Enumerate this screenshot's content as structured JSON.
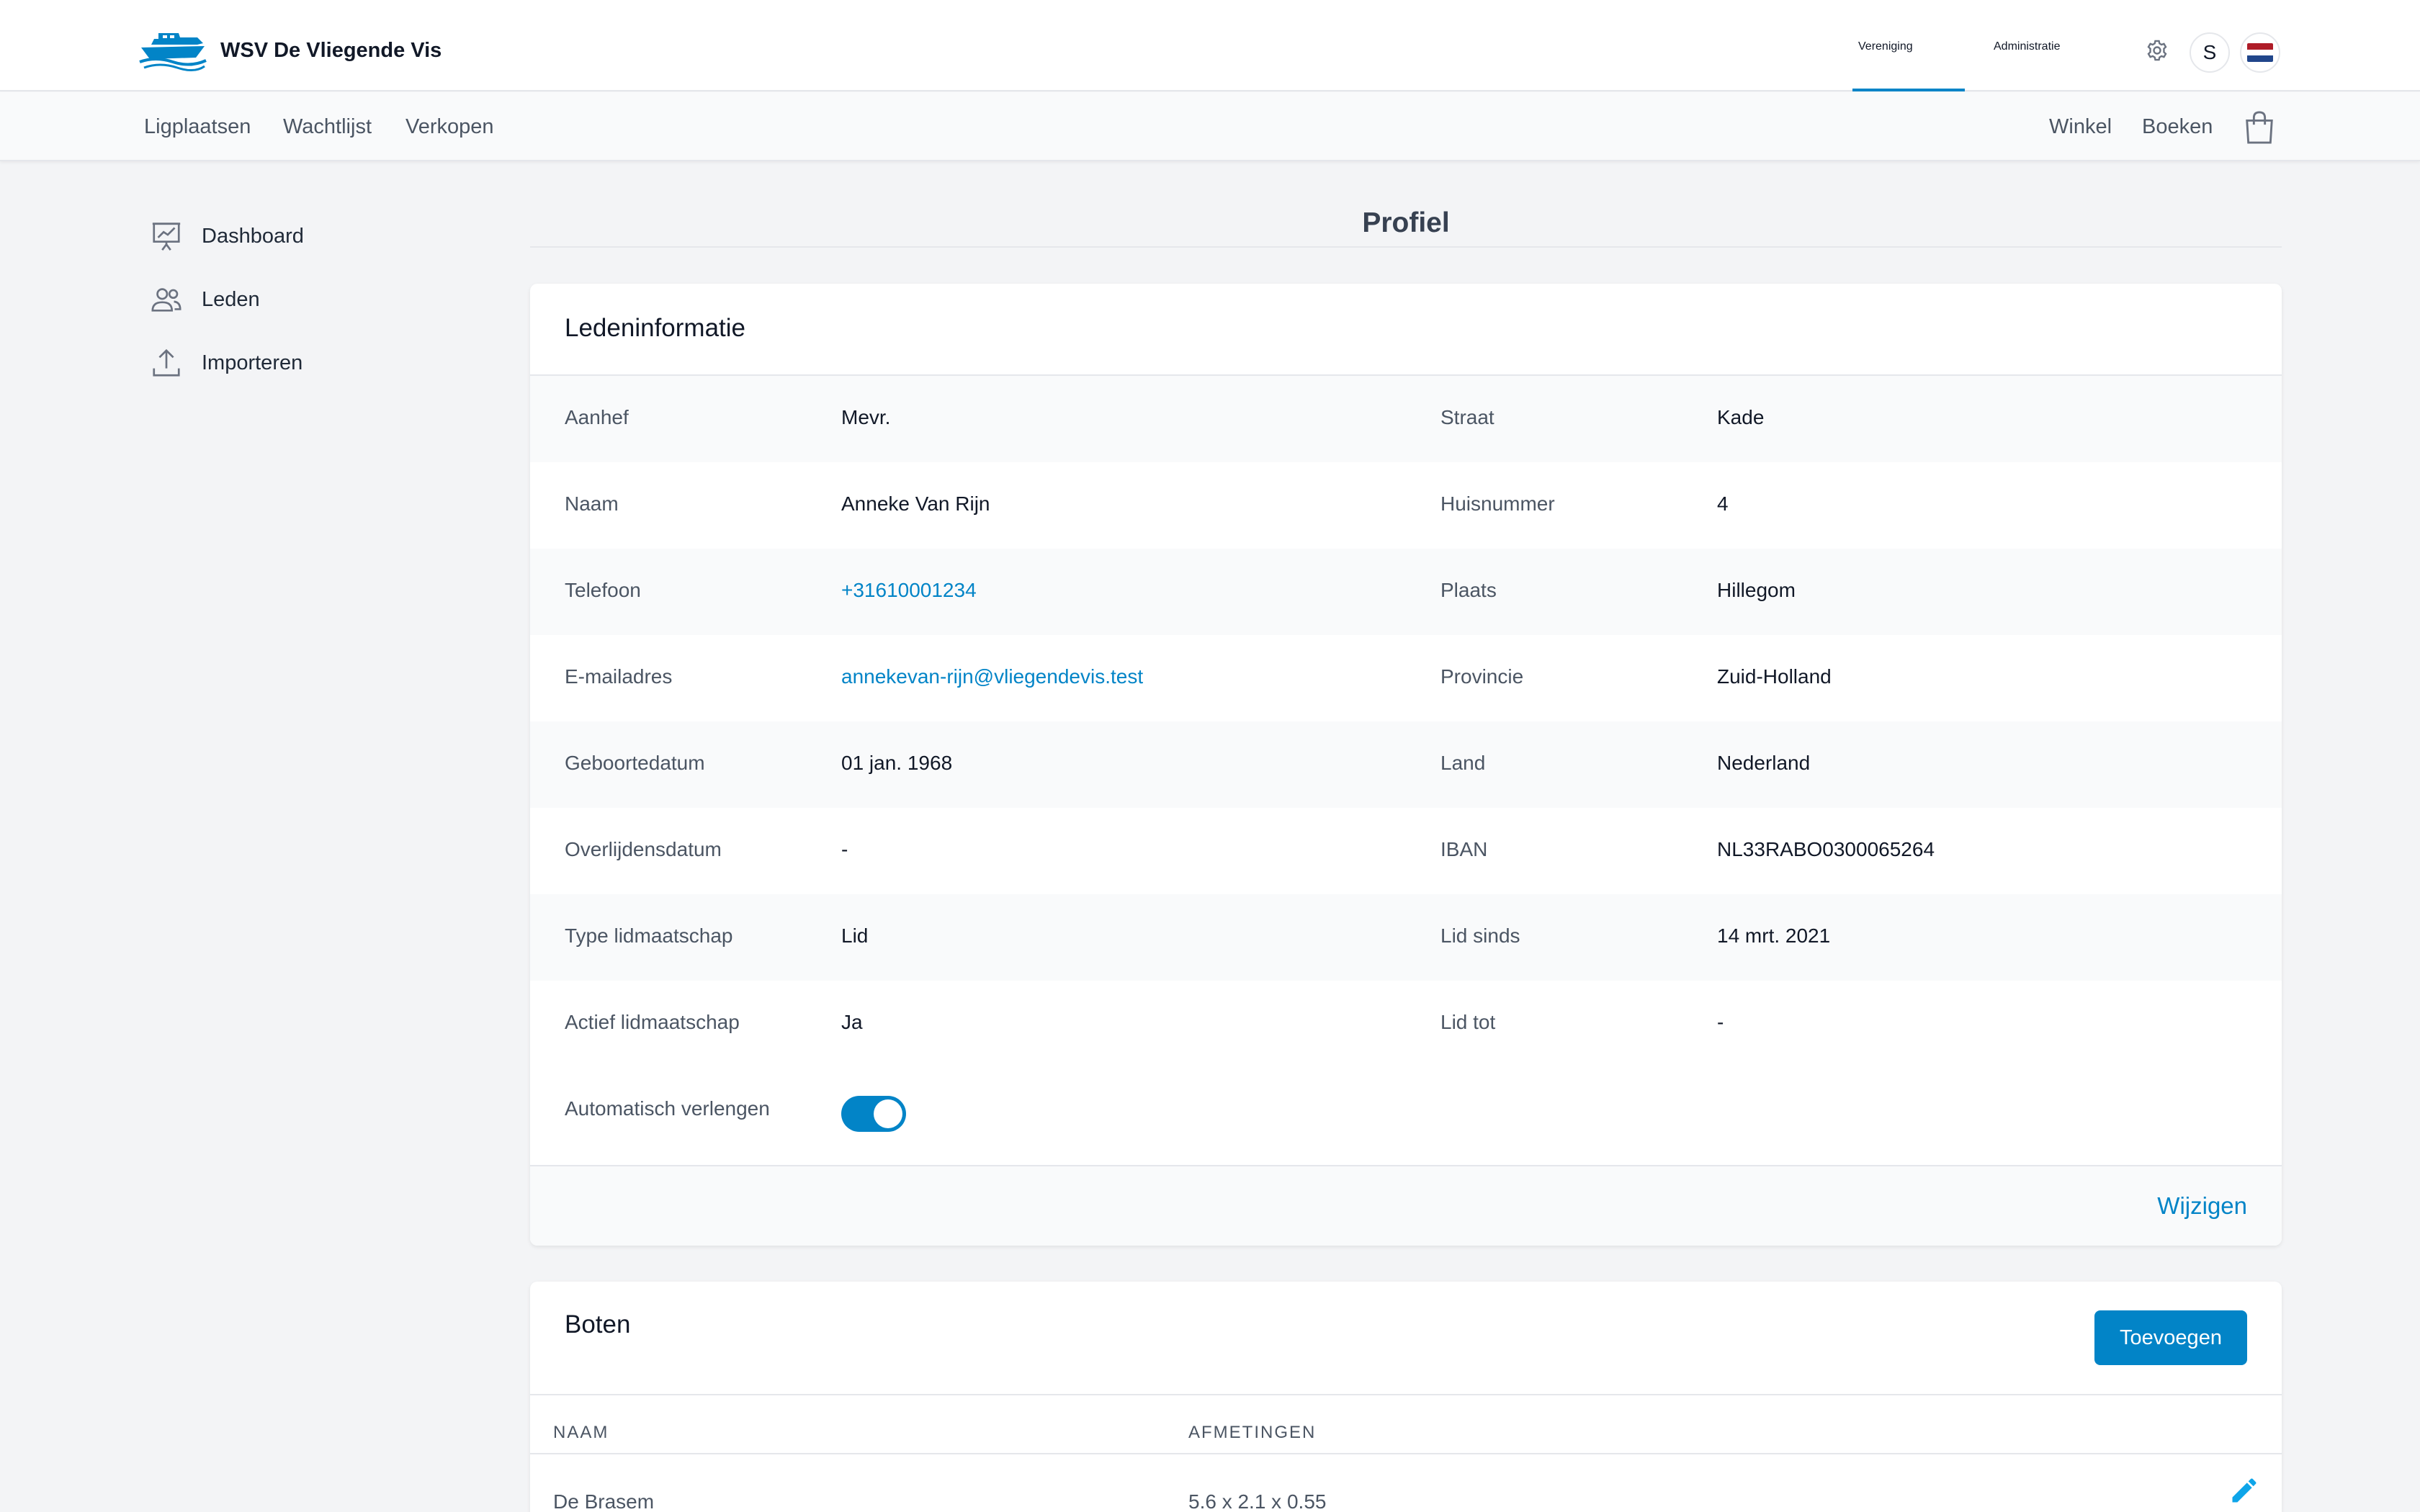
{
  "brand": {
    "name": "WSV De Vliegende Vis",
    "logo_icon": "boat-logo-icon"
  },
  "top_nav": {
    "items": [
      {
        "label": "Vereniging",
        "active": true
      },
      {
        "label": "Administratie",
        "active": false
      }
    ],
    "settings_icon": "gear-icon",
    "avatar_initial": "S",
    "language_icon": "netherlands-flag-icon"
  },
  "sub_nav": {
    "left": [
      "Ligplaatsen",
      "Wachtlijst",
      "Verkopen"
    ],
    "right": [
      "Winkel",
      "Boeken"
    ],
    "cart_icon": "shopping-bag-icon"
  },
  "sidebar": {
    "items": [
      {
        "label": "Dashboard",
        "icon": "presentation-chart-icon"
      },
      {
        "label": "Leden",
        "icon": "users-icon"
      },
      {
        "label": "Importeren",
        "icon": "upload-icon"
      }
    ]
  },
  "page": {
    "title": "Profiel"
  },
  "member_card": {
    "title": "Ledeninformatie",
    "rows": [
      {
        "l1": "Aanhef",
        "v1": "Mevr.",
        "l2": "Straat",
        "v2": "Kade"
      },
      {
        "l1": "Naam",
        "v1": "Anneke Van Rijn",
        "l2": "Huisnummer",
        "v2": "4"
      },
      {
        "l1": "Telefoon",
        "v1": "+31610001234",
        "l2": "Plaats",
        "v2": "Hillegom"
      },
      {
        "l1": "E-mailadres",
        "v1": "annekevan-rijn@vliegendevis.test",
        "l2": "Provincie",
        "v2": "Zuid-Holland"
      },
      {
        "l1": "Geboortedatum",
        "v1": "01 jan. 1968",
        "l2": "Land",
        "v2": "Nederland"
      },
      {
        "l1": "Overlijdensdatum",
        "v1": "-",
        "l2": "IBAN",
        "v2": "NL33RABO0300065264"
      },
      {
        "l1": "Type lidmaatschap",
        "v1": "Lid",
        "l2": "Lid sinds",
        "v2": "14 mrt. 2021"
      },
      {
        "l1": "Actief lidmaatschap",
        "v1": "Ja",
        "l2": "Lid tot",
        "v2": "-"
      }
    ],
    "auto_renew_label": "Automatisch verlengen",
    "auto_renew_on": true,
    "edit_label": "Wijzigen"
  },
  "boats_card": {
    "title": "Boten",
    "add_label": "Toevoegen",
    "columns": [
      "NAAM",
      "AFMETINGEN"
    ],
    "rows": [
      {
        "name": "De Brasem",
        "dimensions": "5.6 x 2.1 x 0.55"
      }
    ],
    "edit_icon": "pencil-icon"
  },
  "colors": {
    "accent": "#0284c7",
    "background": "#f3f4f6",
    "card": "#ffffff"
  }
}
